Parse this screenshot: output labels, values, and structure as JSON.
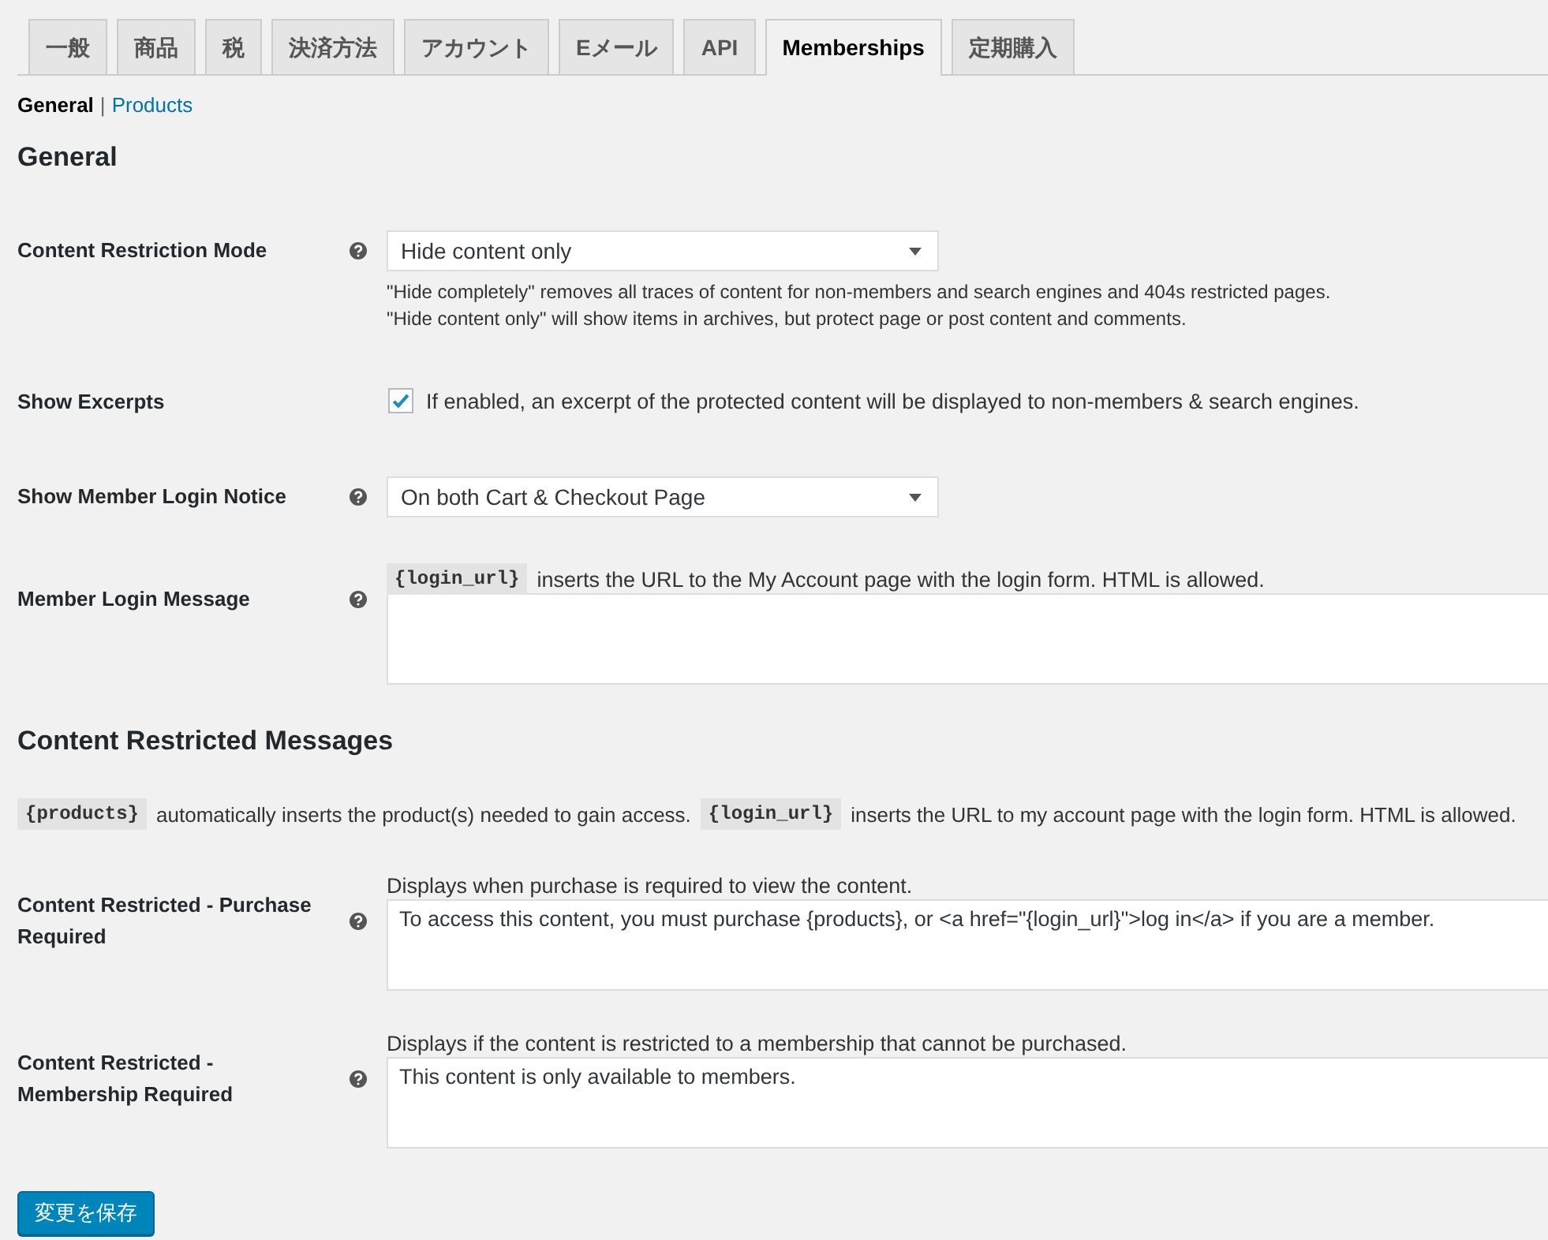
{
  "tabs": [
    {
      "label": "一般",
      "selected": false
    },
    {
      "label": "商品",
      "selected": false
    },
    {
      "label": "税",
      "selected": false
    },
    {
      "label": "決済方法",
      "selected": false
    },
    {
      "label": "アカウント",
      "selected": false
    },
    {
      "label": "Eメール",
      "selected": false
    },
    {
      "label": "API",
      "selected": false
    },
    {
      "label": "Memberships",
      "selected": true
    },
    {
      "label": "定期購入",
      "selected": false
    }
  ],
  "subnav": {
    "separator": "|",
    "links": [
      {
        "label": "General",
        "selected": true
      },
      {
        "label": "Products",
        "selected": false
      }
    ]
  },
  "sections": [
    {
      "title": "General",
      "rows": [
        {
          "kind": "select",
          "label": "Content Restriction Mode",
          "help": true,
          "value": "Hide content only",
          "notes": [
            "\"Hide completely\" removes all traces of content for non-members and search engines and 404s restricted pages.",
            "\"Hide content only\" will show items in archives, but protect page or post content and comments."
          ]
        },
        {
          "kind": "checkbox",
          "label": "Show Excerpts",
          "help": false,
          "checked": true,
          "text": "If enabled, an excerpt of the protected content will be displayed to non-members & search engines."
        },
        {
          "kind": "select",
          "label": "Show Member Login Notice",
          "help": true,
          "value": "On both Cart & Checkout Page"
        },
        {
          "kind": "textarea",
          "label": "Member Login Message",
          "help": true,
          "intro": [
            {
              "kind": "code",
              "text": "{login_url}"
            },
            {
              "kind": "text",
              "text": "inserts the URL to the My Account page with the login form. HTML is allowed."
            }
          ]
        }
      ]
    },
    {
      "title": "Content Restricted Messages",
      "intro": [
        {
          "kind": "code",
          "text": "{products}"
        },
        {
          "kind": "text",
          "text": "automatically inserts the product(s) needed to gain access."
        },
        {
          "kind": "code",
          "text": "{login_url}"
        },
        {
          "kind": "text",
          "text": "inserts the URL to my account page with the login form. HTML is allowed."
        }
      ],
      "rows": [
        {
          "kind": "textarea",
          "label": "Content Restricted - Purchase Required",
          "help": true,
          "intro": [
            {
              "kind": "text",
              "text": "Displays when purchase is required to view the content."
            }
          ],
          "value": "To access this content, you must purchase {products}, or <a href=\"{login_url}\">log in</a> if you are a member."
        },
        {
          "kind": "textarea",
          "label": "Content Restricted - Membership Required",
          "help": true,
          "intro": [
            {
              "kind": "text",
              "text": "Displays if the content is restricted to a membership that cannot be purchased."
            }
          ],
          "value": "This content is only available to members."
        }
      ]
    }
  ],
  "save_button": "変更を保存"
}
